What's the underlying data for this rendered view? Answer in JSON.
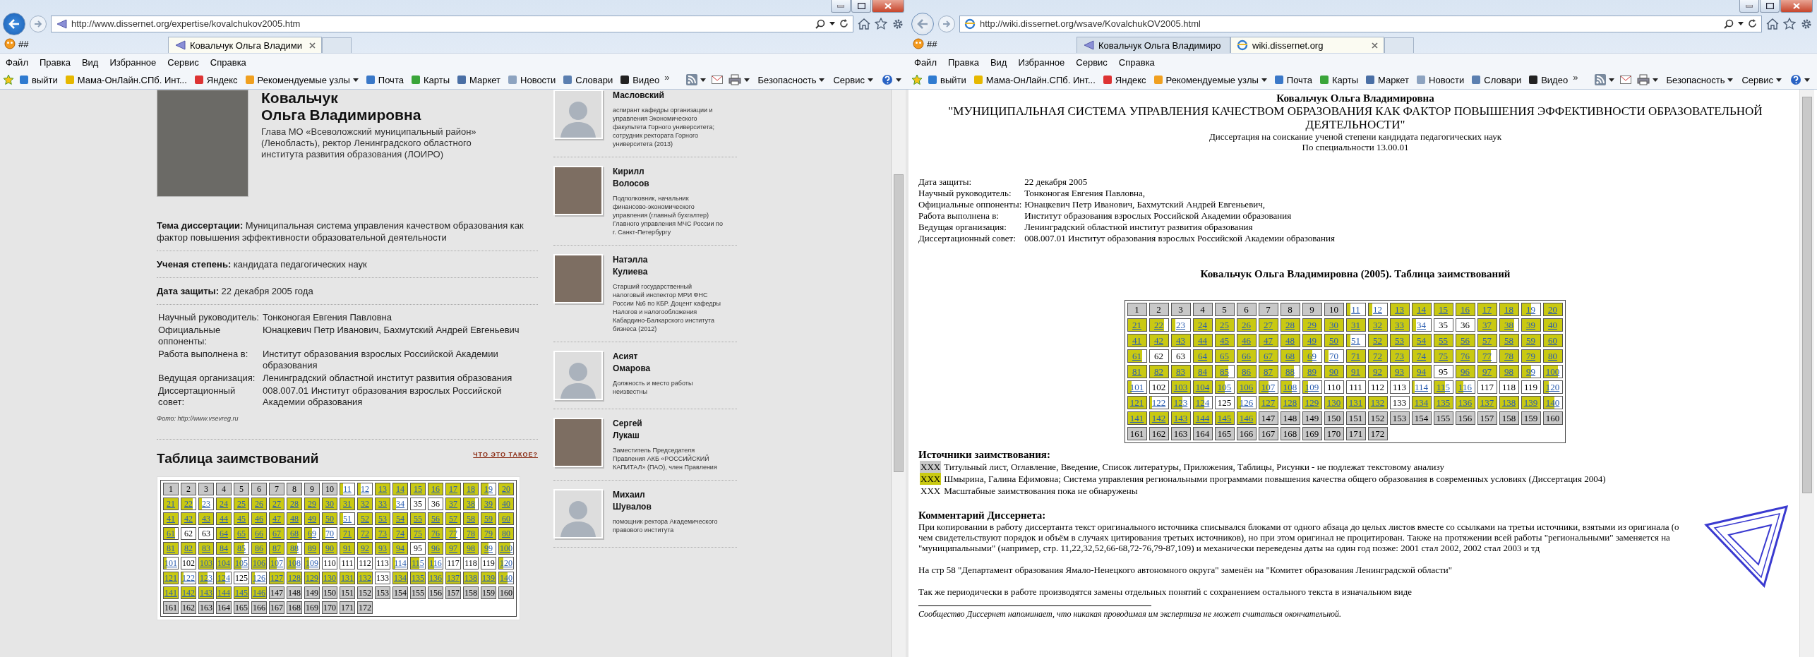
{
  "windows": [
    {
      "back_enabled": true,
      "address": "http://www.dissernet.org/expertise/kovalchukov2005.htm",
      "pinned_tab": "##",
      "tabs": [
        {
          "label": "Ковальчук Ольга Владими",
          "selected": true
        }
      ],
      "menu": [
        "Файл",
        "Правка",
        "Вид",
        "Избранное",
        "Сервис",
        "Справка"
      ],
      "favorites": [
        "выйти",
        "Мама-ОнЛайн.СПб. Инт...",
        "Яндекс",
        "Рекомендуемые узлы",
        "Почта",
        "Карты",
        "Маркет",
        "Новости",
        "Словари",
        "Видео"
      ],
      "chevron": "»",
      "tools": [
        "Безопасность",
        "Сервис"
      ]
    },
    {
      "back_enabled": false,
      "address": "http://wiki.dissernet.org/wsave/KovalchukOV2005.html",
      "pinned_tab": "##",
      "tabs": [
        {
          "label": "Ковальчук Ольга Владимиро",
          "selected": false
        },
        {
          "label": "wiki.dissernet.org",
          "selected": true
        }
      ],
      "menu": [
        "Файл",
        "Правка",
        "Вид",
        "Избранное",
        "Сервис",
        "Справка"
      ],
      "favorites": [
        "выйти",
        "Мама-ОнЛайн.СПб. Инт...",
        "Яндекс",
        "Рекомендуемые узлы",
        "Почта",
        "Карты",
        "Маркет",
        "Новости",
        "Словари",
        "Видео"
      ],
      "chevron": "»",
      "tools": [
        "Безопасность",
        "Сервис"
      ]
    }
  ],
  "profile": {
    "surname": "Ковальчук",
    "given_names": "Ольга Владимировна",
    "position": "Глава МО «Всеволожский муниципальный район» (Ленобласть), ректор Ленинградского областного института развития образования (ЛОИРО)",
    "facts": [
      {
        "label": "Тема диссертации:",
        "value": "Муниципальная система управления качеством образования как фактор повышения эффективности образовательной деятельности"
      },
      {
        "label": "Ученая степень:",
        "value": "кандидата педагогических наук"
      },
      {
        "label": "Дата защиты:",
        "value": "22 декабря 2005 года"
      }
    ],
    "details": [
      {
        "label": "Научный руководитель:",
        "value": "Тонконогая Евгения Павловна"
      },
      {
        "label": "Официальные оппоненты:",
        "value": "Юнацкевич Петр Иванович, Бахмутский Андрей Евгеньевич"
      },
      {
        "label": "Работа выполнена в:",
        "value": "Институт образования взрослых Российской Академии образования"
      },
      {
        "label": "Ведущая организация:",
        "value": "Ленинградский областной институт развития образования"
      },
      {
        "label": "Диссертационный совет:",
        "value": "008.007.01 Институт образования взрослых Российской Академии образования"
      }
    ],
    "photo_credit": "Фото: http://www.vsevreg.ru",
    "table_title": "Таблица заимствований",
    "help_link": "ЧТО ЭТО ТАКОЕ?",
    "table": {
      "cells": [
        {
          "label": "1",
          "kind": "gray"
        },
        {
          "label": "2",
          "kind": "gray"
        },
        {
          "label": "3",
          "kind": "gray"
        },
        {
          "label": "4",
          "kind": "gray"
        },
        {
          "label": "5",
          "kind": "gray"
        },
        {
          "label": "6",
          "kind": "gray"
        },
        {
          "label": "7",
          "kind": "gray"
        },
        {
          "label": "8",
          "kind": "gray"
        },
        {
          "label": "9",
          "kind": "gray"
        },
        {
          "label": "10",
          "kind": "gray"
        },
        {
          "label": "11",
          "kind": "partial",
          "level": 0.2
        },
        {
          "label": "12",
          "kind": "partial",
          "level": 0.2
        },
        {
          "label": "13",
          "kind": "yellow"
        },
        {
          "label": "14",
          "kind": "yellow"
        },
        {
          "label": "15",
          "kind": "yellow"
        },
        {
          "label": "16",
          "kind": "yellow"
        },
        {
          "label": "17",
          "kind": "yellow"
        },
        {
          "label": "18",
          "kind": "yellow"
        },
        {
          "label": "19",
          "kind": "partial",
          "level": 0.5
        },
        {
          "label": "20",
          "kind": "yellow"
        },
        {
          "label": "21",
          "kind": "yellow"
        },
        {
          "label": "22",
          "kind": "partial",
          "level": 0.8
        },
        {
          "label": "23",
          "kind": "partial",
          "level": 0.2
        },
        {
          "label": "24",
          "kind": "yellow"
        },
        {
          "label": "25",
          "kind": "yellow"
        },
        {
          "label": "26",
          "kind": "yellow"
        },
        {
          "label": "27",
          "kind": "yellow"
        },
        {
          "label": "28",
          "kind": "yellow"
        },
        {
          "label": "29",
          "kind": "yellow"
        },
        {
          "label": "30",
          "kind": "yellow"
        },
        {
          "label": "31",
          "kind": "yellow"
        },
        {
          "label": "32",
          "kind": "yellow"
        },
        {
          "label": "33",
          "kind": "yellow"
        },
        {
          "label": "34",
          "kind": "partial",
          "level": 0.2
        },
        {
          "label": "35",
          "kind": "white"
        },
        {
          "label": "36",
          "kind": "white"
        },
        {
          "label": "37",
          "kind": "yellow"
        },
        {
          "label": "38",
          "kind": "partial",
          "level": 0.8
        },
        {
          "label": "39",
          "kind": "yellow"
        },
        {
          "label": "40",
          "kind": "yellow"
        },
        {
          "label": "41",
          "kind": "yellow"
        },
        {
          "label": "42",
          "kind": "yellow"
        },
        {
          "label": "43",
          "kind": "yellow"
        },
        {
          "label": "44",
          "kind": "yellow"
        },
        {
          "label": "45",
          "kind": "yellow"
        },
        {
          "label": "46",
          "kind": "yellow"
        },
        {
          "label": "47",
          "kind": "yellow"
        },
        {
          "label": "48",
          "kind": "yellow"
        },
        {
          "label": "49",
          "kind": "yellow"
        },
        {
          "label": "50",
          "kind": "yellow"
        },
        {
          "label": "51",
          "kind": "partial",
          "level": 0.2
        },
        {
          "label": "52",
          "kind": "yellow"
        },
        {
          "label": "53",
          "kind": "yellow"
        },
        {
          "label": "54",
          "kind": "yellow"
        },
        {
          "label": "55",
          "kind": "yellow"
        },
        {
          "label": "56",
          "kind": "yellow"
        },
        {
          "label": "57",
          "kind": "yellow"
        },
        {
          "label": "58",
          "kind": "yellow"
        },
        {
          "label": "59",
          "kind": "yellow"
        },
        {
          "label": "60",
          "kind": "yellow"
        },
        {
          "label": "61",
          "kind": "partial",
          "level": 0.8
        },
        {
          "label": "62",
          "kind": "white"
        },
        {
          "label": "63",
          "kind": "white"
        },
        {
          "label": "64",
          "kind": "yellow"
        },
        {
          "label": "65",
          "kind": "yellow"
        },
        {
          "label": "66",
          "kind": "yellow"
        },
        {
          "label": "67",
          "kind": "yellow"
        },
        {
          "label": "68",
          "kind": "yellow"
        },
        {
          "label": "69",
          "kind": "partial",
          "level": 0.5
        },
        {
          "label": "70",
          "kind": "partial",
          "level": 0.2
        },
        {
          "label": "71",
          "kind": "yellow"
        },
        {
          "label": "72",
          "kind": "yellow"
        },
        {
          "label": "73",
          "kind": "yellow"
        },
        {
          "label": "74",
          "kind": "yellow"
        },
        {
          "label": "75",
          "kind": "yellow"
        },
        {
          "label": "76",
          "kind": "yellow"
        },
        {
          "label": "77",
          "kind": "partial",
          "level": 0.7
        },
        {
          "label": "78",
          "kind": "yellow"
        },
        {
          "label": "79",
          "kind": "yellow"
        },
        {
          "label": "80",
          "kind": "yellow"
        },
        {
          "label": "81",
          "kind": "yellow"
        },
        {
          "label": "82",
          "kind": "yellow"
        },
        {
          "label": "83",
          "kind": "yellow"
        },
        {
          "label": "84",
          "kind": "yellow"
        },
        {
          "label": "85",
          "kind": "partial",
          "level": 0.7
        },
        {
          "label": "86",
          "kind": "yellow"
        },
        {
          "label": "87",
          "kind": "yellow"
        },
        {
          "label": "88",
          "kind": "partial",
          "level": 0.7
        },
        {
          "label": "89",
          "kind": "yellow"
        },
        {
          "label": "90",
          "kind": "yellow"
        },
        {
          "label": "91",
          "kind": "yellow"
        },
        {
          "label": "92",
          "kind": "yellow"
        },
        {
          "label": "93",
          "kind": "yellow"
        },
        {
          "label": "94",
          "kind": "yellow"
        },
        {
          "label": "95",
          "kind": "white"
        },
        {
          "label": "96",
          "kind": "yellow"
        },
        {
          "label": "97",
          "kind": "yellow"
        },
        {
          "label": "98",
          "kind": "yellow"
        },
        {
          "label": "99",
          "kind": "partial",
          "level": 0.5
        },
        {
          "label": "100",
          "kind": "partial",
          "level": 0.8
        },
        {
          "label": "101",
          "kind": "partial",
          "level": 0.2
        },
        {
          "label": "102",
          "kind": "white"
        },
        {
          "label": "103",
          "kind": "yellow"
        },
        {
          "label": "104",
          "kind": "yellow"
        },
        {
          "label": "105",
          "kind": "partial",
          "level": 0.5
        },
        {
          "label": "106",
          "kind": "yellow"
        },
        {
          "label": "107",
          "kind": "partial",
          "level": 0.5
        },
        {
          "label": "108",
          "kind": "partial",
          "level": 0.6
        },
        {
          "label": "109",
          "kind": "partial",
          "level": 0.3
        },
        {
          "label": "110",
          "kind": "white"
        },
        {
          "label": "111",
          "kind": "white"
        },
        {
          "label": "112",
          "kind": "white"
        },
        {
          "label": "113",
          "kind": "white"
        },
        {
          "label": "114",
          "kind": "partial",
          "level": 0.15
        },
        {
          "label": "115",
          "kind": "partial",
          "level": 0.6
        },
        {
          "label": "116",
          "kind": "partial",
          "level": 0.4
        },
        {
          "label": "117",
          "kind": "white"
        },
        {
          "label": "118",
          "kind": "white"
        },
        {
          "label": "119",
          "kind": "white"
        },
        {
          "label": "120",
          "kind": "partial",
          "level": 0.3
        },
        {
          "label": "121",
          "kind": "yellow"
        },
        {
          "label": "122",
          "kind": "partial",
          "level": 0.15
        },
        {
          "label": "123",
          "kind": "partial",
          "level": 0.6
        },
        {
          "label": "124",
          "kind": "partial",
          "level": 0.6
        },
        {
          "label": "125",
          "kind": "white"
        },
        {
          "label": "126",
          "kind": "partial",
          "level": 0.2
        },
        {
          "label": "127",
          "kind": "yellow"
        },
        {
          "label": "128",
          "kind": "yellow"
        },
        {
          "label": "129",
          "kind": "yellow"
        },
        {
          "label": "130",
          "kind": "yellow"
        },
        {
          "label": "131",
          "kind": "yellow"
        },
        {
          "label": "132",
          "kind": "yellow"
        },
        {
          "label": "133",
          "kind": "white"
        },
        {
          "label": "134",
          "kind": "yellow"
        },
        {
          "label": "135",
          "kind": "yellow"
        },
        {
          "label": "136",
          "kind": "yellow"
        },
        {
          "label": "137",
          "kind": "yellow"
        },
        {
          "label": "138",
          "kind": "yellow"
        },
        {
          "label": "139",
          "kind": "yellow"
        },
        {
          "label": "140",
          "kind": "partial",
          "level": 0.6
        },
        {
          "label": "141",
          "kind": "yellow"
        },
        {
          "label": "142",
          "kind": "yellow"
        },
        {
          "label": "143",
          "kind": "yellow"
        },
        {
          "label": "144",
          "kind": "yellow"
        },
        {
          "label": "145",
          "kind": "yellow"
        },
        {
          "label": "146",
          "kind": "yellow"
        },
        {
          "label": "147",
          "kind": "gray"
        },
        {
          "label": "148",
          "kind": "gray"
        },
        {
          "label": "149",
          "kind": "gray"
        },
        {
          "label": "150",
          "kind": "gray"
        },
        {
          "label": "151",
          "kind": "gray"
        },
        {
          "label": "152",
          "kind": "gray"
        },
        {
          "label": "153",
          "kind": "gray"
        },
        {
          "label": "154",
          "kind": "gray"
        },
        {
          "label": "155",
          "kind": "gray"
        },
        {
          "label": "156",
          "kind": "gray"
        },
        {
          "label": "157",
          "kind": "gray"
        },
        {
          "label": "158",
          "kind": "gray"
        },
        {
          "label": "159",
          "kind": "gray"
        },
        {
          "label": "160",
          "kind": "gray"
        },
        {
          "label": "161",
          "kind": "gray"
        },
        {
          "label": "162",
          "kind": "gray"
        },
        {
          "label": "163",
          "kind": "gray"
        },
        {
          "label": "164",
          "kind": "gray"
        },
        {
          "label": "165",
          "kind": "gray"
        },
        {
          "label": "166",
          "kind": "gray"
        },
        {
          "label": "167",
          "kind": "gray"
        },
        {
          "label": "168",
          "kind": "gray"
        },
        {
          "label": "169",
          "kind": "gray"
        },
        {
          "label": "170",
          "kind": "gray"
        },
        {
          "label": "171",
          "kind": "gray"
        },
        {
          "label": "172",
          "kind": "gray"
        }
      ]
    },
    "people": [
      {
        "kind": "silhouette",
        "last_name": "Масловский",
        "description": "аспирант кафедры организации и управления Экономического факультета Горного университета; сотрудник ректората Горного университета (2013)"
      },
      {
        "kind": "photo",
        "first_name": "Кирилл",
        "last_name": "Волосов",
        "description": "Подполковник, начальник финансово-экономического управления (главный бухгалтер) Главного управления МЧС России по г. Санкт-Петербургу"
      },
      {
        "kind": "photo",
        "first_name": "Натэлла",
        "last_name": "Кулиева",
        "description": "Старший государственный налоговый инспектор МРИ ФНС России №6 по КБР. Доцент кафедры Налогов и налогообложения Кабардино-Балкарского института бизнеса (2012)"
      },
      {
        "kind": "silhouette",
        "first_name": "Асият",
        "last_name": "Омарова",
        "description": "Должность и место работы неизвестны"
      },
      {
        "kind": "photo",
        "first_name": "Сергей",
        "last_name": "Лукаш",
        "description": "Заместитель Председателя Правления АКБ «РОССИЙСКИЙ КАПИТАЛ» (ПАО), член Правления"
      },
      {
        "kind": "silhouette",
        "first_name": "Михаил",
        "last_name": "Шувалов",
        "description": "помощник ректора Академического правового института"
      }
    ]
  },
  "wiki": {
    "author": "Ковальчук Ольга Владимировна",
    "title": "\"МУНИЦИПАЛЬНАЯ СИСТЕМА УПРАВЛЕНИЯ КАЧЕСТВОМ ОБРАЗОВАНИЯ КАК ФАКТОР ПОВЫШЕНИЯ ЭФФЕКТИВНОСТИ ОБРАЗОВАТЕЛЬНОЙ ДЕЯТЕЛЬНОСТИ\"",
    "degree": "Диссертация на соискание ученой степени кандидата педагогических наук",
    "specialty": "По специальности 13.00.01",
    "info": [
      {
        "label": "Дата защиты:",
        "value": "22 декабря 2005"
      },
      {
        "label": "Научный руководитель:",
        "value": "Тонконогая Евгения Павловна,"
      },
      {
        "label": "Официальные оппоненты:",
        "value": "Юнацкевич Петр Иванович, Бахмутский Андрей Евгеньевич,"
      },
      {
        "label": "Работа выполнена в:",
        "value": "Институт образования взрослых Российской Академии образования"
      },
      {
        "label": "Ведущая организация:",
        "value": "Ленинградский областной институт развития образования"
      },
      {
        "label": "Диссертационный совет:",
        "value": "008.007.01 Институт образования взрослых Российской Академии образования"
      }
    ],
    "table_title": "Ковальчук Ольга Владимировна (2005). Таблица заимствований",
    "table": {
      "cells": [
        {
          "label": "1",
          "kind": "gray"
        },
        {
          "label": "2",
          "kind": "gray"
        },
        {
          "label": "3",
          "kind": "gray"
        },
        {
          "label": "4",
          "kind": "gray"
        },
        {
          "label": "5",
          "kind": "gray"
        },
        {
          "label": "6",
          "kind": "gray"
        },
        {
          "label": "7",
          "kind": "gray"
        },
        {
          "label": "8",
          "kind": "gray"
        },
        {
          "label": "9",
          "kind": "gray"
        },
        {
          "label": "10",
          "kind": "gray"
        },
        {
          "label": "11",
          "kind": "partial",
          "level": 0.2
        },
        {
          "label": "12",
          "kind": "partial",
          "level": 0.2
        },
        {
          "label": "13",
          "kind": "yellow"
        },
        {
          "label": "14",
          "kind": "yellow"
        },
        {
          "label": "15",
          "kind": "yellow"
        },
        {
          "label": "16",
          "kind": "yellow"
        },
        {
          "label": "17",
          "kind": "yellow"
        },
        {
          "label": "18",
          "kind": "yellow"
        },
        {
          "label": "19",
          "kind": "partial",
          "level": 0.5
        },
        {
          "label": "20",
          "kind": "yellow"
        },
        {
          "label": "21",
          "kind": "yellow"
        },
        {
          "label": "22",
          "kind": "partial",
          "level": 0.8
        },
        {
          "label": "23",
          "kind": "partial",
          "level": 0.2
        },
        {
          "label": "24",
          "kind": "yellow"
        },
        {
          "label": "25",
          "kind": "yellow"
        },
        {
          "label": "26",
          "kind": "yellow"
        },
        {
          "label": "27",
          "kind": "yellow"
        },
        {
          "label": "28",
          "kind": "yellow"
        },
        {
          "label": "29",
          "kind": "yellow"
        },
        {
          "label": "30",
          "kind": "yellow"
        },
        {
          "label": "31",
          "kind": "yellow"
        },
        {
          "label": "32",
          "kind": "yellow"
        },
        {
          "label": "33",
          "kind": "yellow"
        },
        {
          "label": "34",
          "kind": "partial",
          "level": 0.2
        },
        {
          "label": "35",
          "kind": "white"
        },
        {
          "label": "36",
          "kind": "white"
        },
        {
          "label": "37",
          "kind": "yellow"
        },
        {
          "label": "38",
          "kind": "partial",
          "level": 0.8
        },
        {
          "label": "39",
          "kind": "yellow"
        },
        {
          "label": "40",
          "kind": "yellow"
        },
        {
          "label": "41",
          "kind": "yellow"
        },
        {
          "label": "42",
          "kind": "yellow"
        },
        {
          "label": "43",
          "kind": "yellow"
        },
        {
          "label": "44",
          "kind": "yellow"
        },
        {
          "label": "45",
          "kind": "yellow"
        },
        {
          "label": "46",
          "kind": "yellow"
        },
        {
          "label": "47",
          "kind": "yellow"
        },
        {
          "label": "48",
          "kind": "yellow"
        },
        {
          "label": "49",
          "kind": "yellow"
        },
        {
          "label": "50",
          "kind": "yellow"
        },
        {
          "label": "51",
          "kind": "partial",
          "level": 0.2
        },
        {
          "label": "52",
          "kind": "yellow"
        },
        {
          "label": "53",
          "kind": "yellow"
        },
        {
          "label": "54",
          "kind": "yellow"
        },
        {
          "label": "55",
          "kind": "yellow"
        },
        {
          "label": "56",
          "kind": "yellow"
        },
        {
          "label": "57",
          "kind": "yellow"
        },
        {
          "label": "58",
          "kind": "yellow"
        },
        {
          "label": "59",
          "kind": "yellow"
        },
        {
          "label": "60",
          "kind": "yellow"
        },
        {
          "label": "61",
          "kind": "partial",
          "level": 0.8
        },
        {
          "label": "62",
          "kind": "white"
        },
        {
          "label": "63",
          "kind": "white"
        },
        {
          "label": "64",
          "kind": "yellow"
        },
        {
          "label": "65",
          "kind": "yellow"
        },
        {
          "label": "66",
          "kind": "yellow"
        },
        {
          "label": "67",
          "kind": "yellow"
        },
        {
          "label": "68",
          "kind": "yellow"
        },
        {
          "label": "69",
          "kind": "partial",
          "level": 0.5
        },
        {
          "label": "70",
          "kind": "partial",
          "level": 0.2
        },
        {
          "label": "71",
          "kind": "yellow"
        },
        {
          "label": "72",
          "kind": "yellow"
        },
        {
          "label": "73",
          "kind": "yellow"
        },
        {
          "label": "74",
          "kind": "yellow"
        },
        {
          "label": "75",
          "kind": "yellow"
        },
        {
          "label": "76",
          "kind": "yellow"
        },
        {
          "label": "77",
          "kind": "partial",
          "level": 0.7
        },
        {
          "label": "78",
          "kind": "yellow"
        },
        {
          "label": "79",
          "kind": "yellow"
        },
        {
          "label": "80",
          "kind": "yellow"
        },
        {
          "label": "81",
          "kind": "yellow"
        },
        {
          "label": "82",
          "kind": "yellow"
        },
        {
          "label": "83",
          "kind": "yellow"
        },
        {
          "label": "84",
          "kind": "yellow"
        },
        {
          "label": "85",
          "kind": "partial",
          "level": 0.7
        },
        {
          "label": "86",
          "kind": "yellow"
        },
        {
          "label": "87",
          "kind": "yellow"
        },
        {
          "label": "88",
          "kind": "partial",
          "level": 0.7
        },
        {
          "label": "89",
          "kind": "yellow"
        },
        {
          "label": "90",
          "kind": "yellow"
        },
        {
          "label": "91",
          "kind": "yellow"
        },
        {
          "label": "92",
          "kind": "yellow"
        },
        {
          "label": "93",
          "kind": "yellow"
        },
        {
          "label": "94",
          "kind": "yellow"
        },
        {
          "label": "95",
          "kind": "white"
        },
        {
          "label": "96",
          "kind": "yellow"
        },
        {
          "label": "97",
          "kind": "yellow"
        },
        {
          "label": "98",
          "kind": "yellow"
        },
        {
          "label": "99",
          "kind": "partial",
          "level": 0.5
        },
        {
          "label": "100",
          "kind": "partial",
          "level": 0.8
        },
        {
          "label": "101",
          "kind": "partial",
          "level": 0.2
        },
        {
          "label": "102",
          "kind": "white"
        },
        {
          "label": "103",
          "kind": "yellow"
        },
        {
          "label": "104",
          "kind": "yellow"
        },
        {
          "label": "105",
          "kind": "partial",
          "level": 0.5
        },
        {
          "label": "106",
          "kind": "yellow"
        },
        {
          "label": "107",
          "kind": "partial",
          "level": 0.5
        },
        {
          "label": "108",
          "kind": "partial",
          "level": 0.6
        },
        {
          "label": "109",
          "kind": "partial",
          "level": 0.3
        },
        {
          "label": "110",
          "kind": "white"
        },
        {
          "label": "111",
          "kind": "white"
        },
        {
          "label": "112",
          "kind": "white"
        },
        {
          "label": "113",
          "kind": "white"
        },
        {
          "label": "114",
          "kind": "partial",
          "level": 0.15
        },
        {
          "label": "115",
          "kind": "partial",
          "level": 0.6
        },
        {
          "label": "116",
          "kind": "partial",
          "level": 0.4
        },
        {
          "label": "117",
          "kind": "white"
        },
        {
          "label": "118",
          "kind": "white"
        },
        {
          "label": "119",
          "kind": "white"
        },
        {
          "label": "120",
          "kind": "partial",
          "level": 0.3
        },
        {
          "label": "121",
          "kind": "yellow"
        },
        {
          "label": "122",
          "kind": "partial",
          "level": 0.15
        },
        {
          "label": "123",
          "kind": "partial",
          "level": 0.6
        },
        {
          "label": "124",
          "kind": "partial",
          "level": 0.6
        },
        {
          "label": "125",
          "kind": "white"
        },
        {
          "label": "126",
          "kind": "partial",
          "level": 0.2
        },
        {
          "label": "127",
          "kind": "yellow"
        },
        {
          "label": "128",
          "kind": "yellow"
        },
        {
          "label": "129",
          "kind": "yellow"
        },
        {
          "label": "130",
          "kind": "yellow"
        },
        {
          "label": "131",
          "kind": "yellow"
        },
        {
          "label": "132",
          "kind": "yellow"
        },
        {
          "label": "133",
          "kind": "white"
        },
        {
          "label": "134",
          "kind": "yellow"
        },
        {
          "label": "135",
          "kind": "yellow"
        },
        {
          "label": "136",
          "kind": "yellow"
        },
        {
          "label": "137",
          "kind": "yellow"
        },
        {
          "label": "138",
          "kind": "yellow"
        },
        {
          "label": "139",
          "kind": "yellow"
        },
        {
          "label": "140",
          "kind": "partial",
          "level": 0.6
        },
        {
          "label": "141",
          "kind": "yellow"
        },
        {
          "label": "142",
          "kind": "yellow"
        },
        {
          "label": "143",
          "kind": "yellow"
        },
        {
          "label": "144",
          "kind": "yellow"
        },
        {
          "label": "145",
          "kind": "yellow"
        },
        {
          "label": "146",
          "kind": "yellow"
        },
        {
          "label": "147",
          "kind": "gray"
        },
        {
          "label": "148",
          "kind": "gray"
        },
        {
          "label": "149",
          "kind": "gray"
        },
        {
          "label": "150",
          "kind": "gray"
        },
        {
          "label": "151",
          "kind": "gray"
        },
        {
          "label": "152",
          "kind": "gray"
        },
        {
          "label": "153",
          "kind": "gray"
        },
        {
          "label": "154",
          "kind": "gray"
        },
        {
          "label": "155",
          "kind": "gray"
        },
        {
          "label": "156",
          "kind": "gray"
        },
        {
          "label": "157",
          "kind": "gray"
        },
        {
          "label": "158",
          "kind": "gray"
        },
        {
          "label": "159",
          "kind": "gray"
        },
        {
          "label": "160",
          "kind": "gray"
        },
        {
          "label": "161",
          "kind": "gray"
        },
        {
          "label": "162",
          "kind": "gray"
        },
        {
          "label": "163",
          "kind": "gray"
        },
        {
          "label": "164",
          "kind": "gray"
        },
        {
          "label": "165",
          "kind": "gray"
        },
        {
          "label": "166",
          "kind": "gray"
        },
        {
          "label": "167",
          "kind": "gray"
        },
        {
          "label": "168",
          "kind": "gray"
        },
        {
          "label": "169",
          "kind": "gray"
        },
        {
          "label": "170",
          "kind": "gray"
        },
        {
          "label": "171",
          "kind": "gray"
        },
        {
          "label": "172",
          "kind": "gray"
        }
      ]
    },
    "sources_title": "Источники заимствования:",
    "sources": [
      {
        "swatch": "XXX",
        "kind": "gray",
        "text": "Титульный лист, Оглавление, Введение, Список литературы, Приложения, Таблицы, Рисунки - не подлежат текстовому анализу"
      },
      {
        "swatch": "XXX",
        "kind": "yellow",
        "text": "Шмырина, Галина Ефимовна; Система управления региональными программами повышения качества общего образования в современных условиях (Диссертация 2004)"
      },
      {
        "swatch": "XXX",
        "kind": "white",
        "text": "Масштабные заимствования пока не обнаружены"
      }
    ],
    "comment_title": "Комментарий Диссернета:",
    "comment": [
      "При копировании в работу диссертанта текст оригинального источника списывался блоками от одного абзаца до целых листов вместе со ссылками на третьи источники, взятыми из оригинала (о чем свидетельствуют порядок и объём в случаях цитирования третьих источников), но при этом оригинал не процитирован. Также на протяжении всей работы \"региональными\" заменяется на \"муниципальными\" (например, стр. 11,22,32,52,66-68,72-76,79-87,109) и механически переведены даты на один год позже: 2001 стал 2002, 2002 стал 2003 и тд",
      "На стр 58 \"Департамент образования Ямало-Ненецкого автономного округа\" заменён на \"Комитет образования Ленинградской области\"",
      "Так же периодически в работе производятся замены отдельных понятий с сохранением остального текста в изначальном виде"
    ],
    "footnote": "Сообщество Диссернет напоминает, что никакая проводимая им экспертиза не может считаться окончательной."
  }
}
